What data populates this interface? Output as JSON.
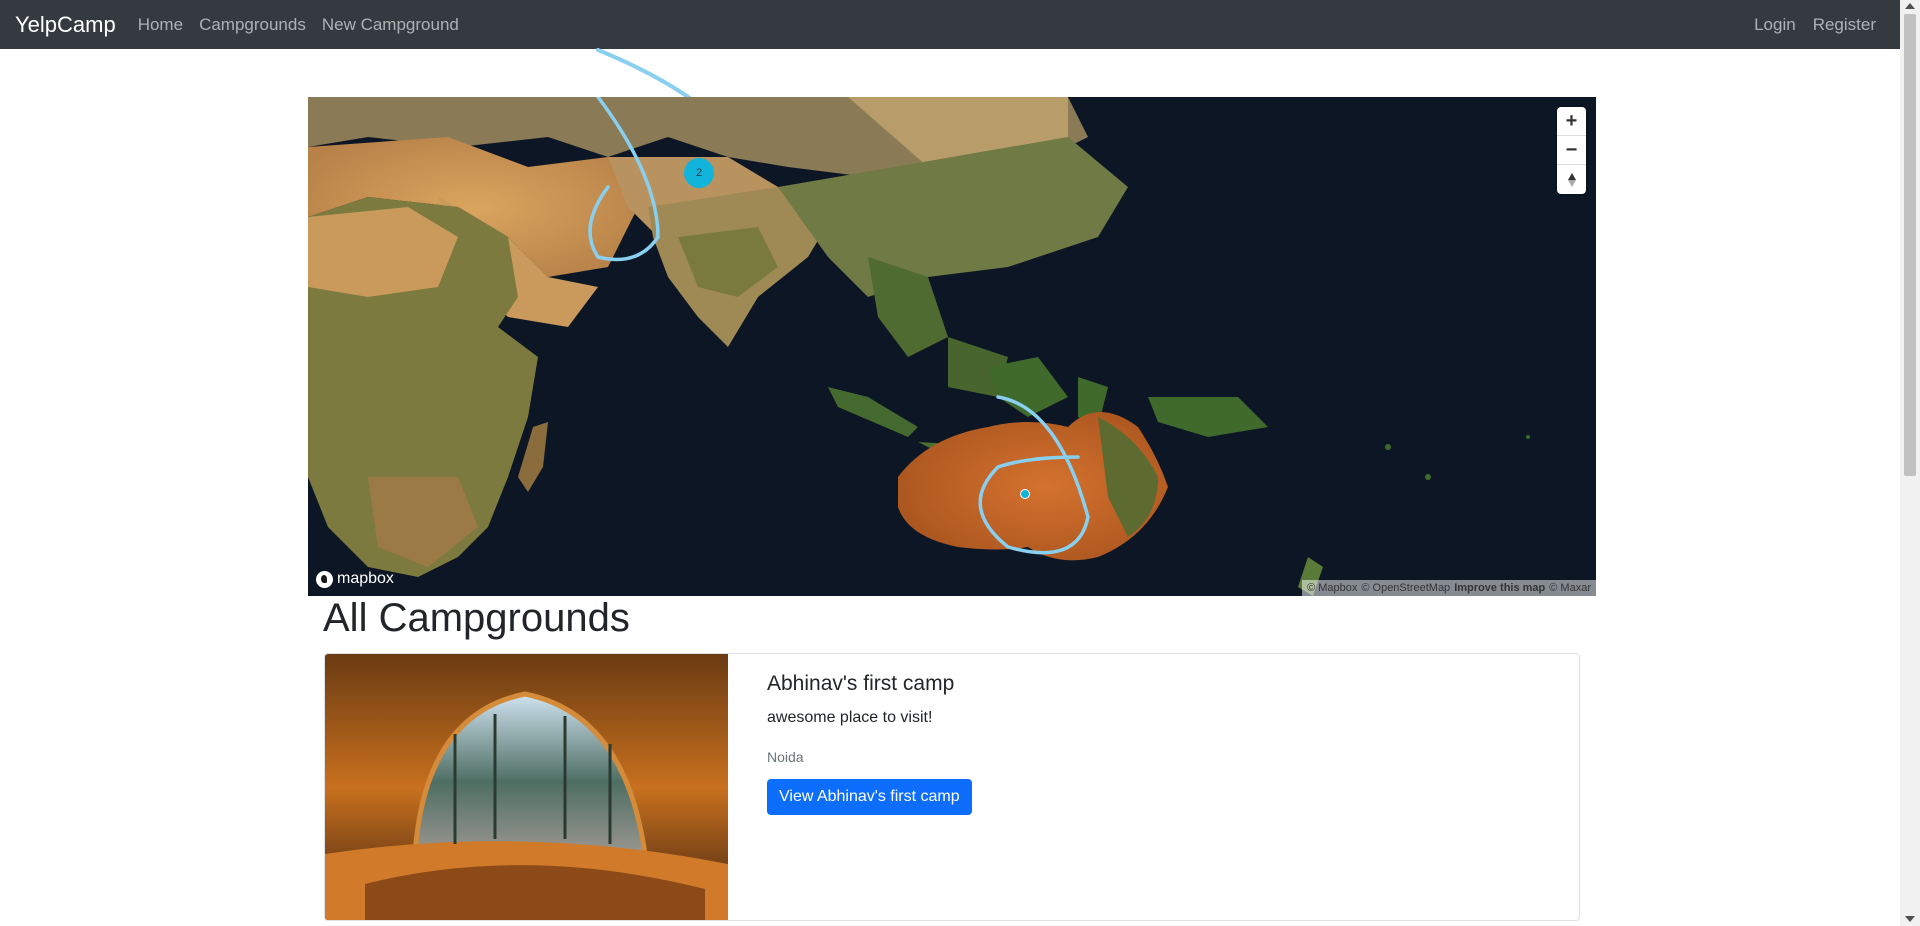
{
  "navbar": {
    "brand": "YelpCamp",
    "links": [
      "Home",
      "Campgrounds",
      "New Campground"
    ],
    "right_links": [
      "Login",
      "Register"
    ]
  },
  "map": {
    "controls": [
      "+",
      "−",
      "▲"
    ],
    "logo_text": "mapbox",
    "attribution": [
      "© Mapbox",
      "© OpenStreetMap",
      "Improve this map",
      "© Maxar"
    ],
    "cluster_count": "2",
    "colors": {
      "cluster": "#11b4da",
      "annotation": "#89cff0"
    }
  },
  "main": {
    "heading": "All Campgrounds",
    "campgrounds": [
      {
        "title": "Abhinav's first camp",
        "description": "awesome place to visit!",
        "location": "Noida",
        "button_label": "View Abhinav's first camp"
      }
    ]
  },
  "colors": {
    "navbar_bg": "#343a40",
    "button_bg": "#0d6efd"
  }
}
